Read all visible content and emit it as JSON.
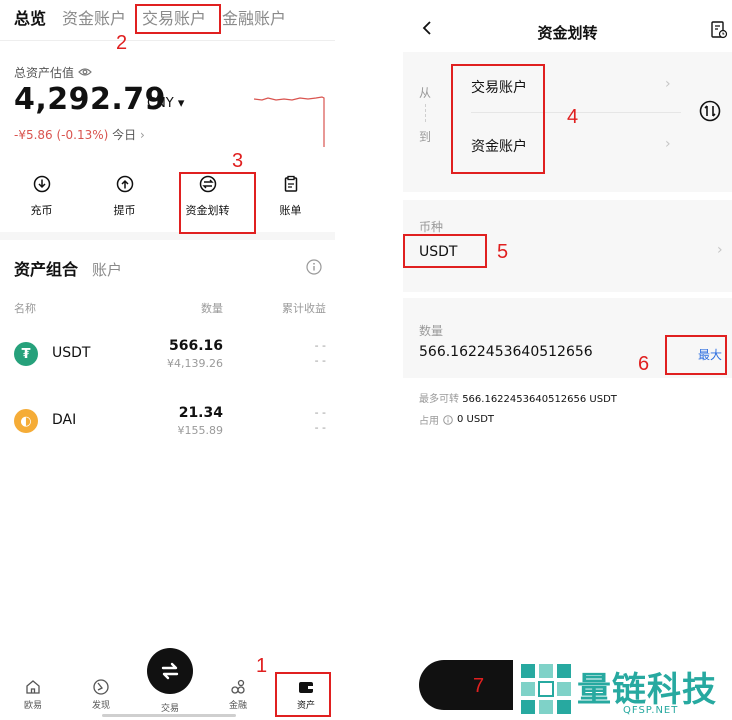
{
  "left": {
    "tabs": [
      "总览",
      "资金账户",
      "交易账户",
      "金融账户"
    ],
    "estimate_label": "总资产估值",
    "total_balance": "4,292.79",
    "currency": "CNY ▾",
    "change_amount": "-¥5.86 (-0.13%)",
    "change_period": "今日",
    "actions": [
      "充币",
      "提币",
      "资金划转",
      "账单"
    ],
    "portfolio_tabs": [
      "资产组合",
      "账户"
    ],
    "columns": {
      "name": "名称",
      "quantity": "数量",
      "pnl": "累计收益"
    },
    "assets": [
      {
        "symbol": "USDT",
        "quantity": "566.16",
        "value": "¥4,139.26",
        "pnl_top": "- -",
        "pnl_bottom": "- -",
        "color": "#26a17b",
        "icon": "₮"
      },
      {
        "symbol": "DAI",
        "quantity": "21.34",
        "value": "¥155.89",
        "pnl_top": "- -",
        "pnl_bottom": "- -",
        "color": "#f5ac37",
        "icon": "◐"
      }
    ],
    "nav": [
      "欧易",
      "发现",
      "交易",
      "金融",
      "资产"
    ]
  },
  "right": {
    "title": "资金划转",
    "from_label": "从",
    "to_label": "到",
    "from_account": "交易账户",
    "to_account": "资金账户",
    "coin_label": "币种",
    "coin_value": "USDT",
    "amount_label": "数量",
    "amount_value": "566.1622453640512656",
    "max_label": "最大",
    "available_label": "最多可转",
    "available_value": "566.1622453640512656 USDT",
    "occupied_label": "占用",
    "occupied_value": "0 USDT"
  },
  "annotations": [
    "1",
    "2",
    "3",
    "4",
    "5",
    "6",
    "7"
  ],
  "watermark": {
    "text": "量链科技",
    "sub": "QFSP.NET"
  }
}
